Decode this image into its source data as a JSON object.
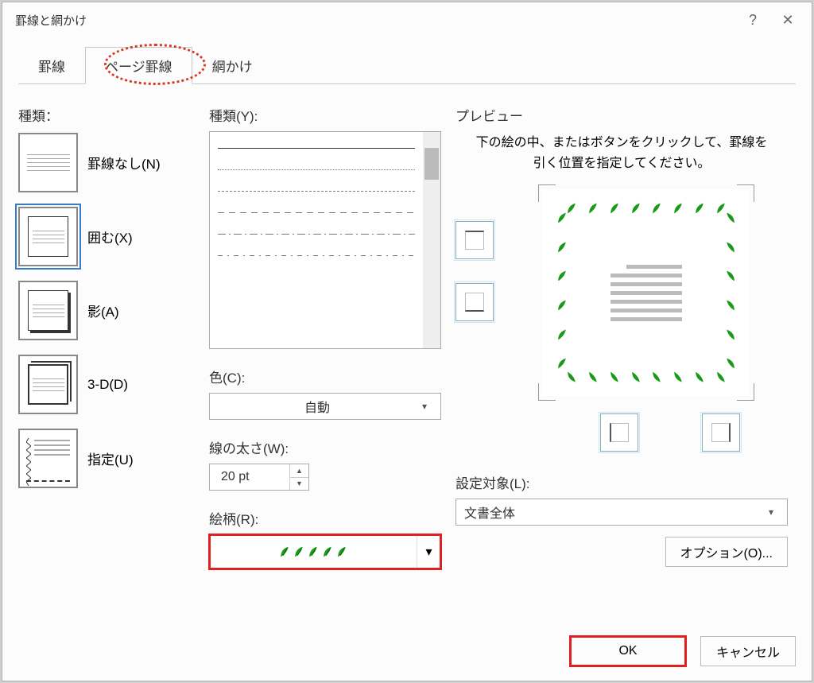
{
  "window": {
    "title": "罫線と網かけ"
  },
  "tabs": {
    "borders": "罫線",
    "page_borders": "ページ罫線",
    "shading": "網かけ"
  },
  "col1": {
    "heading": "種類：",
    "items": [
      {
        "label": "罫線なし(N)",
        "key": "none"
      },
      {
        "label": "囲む(X)",
        "key": "box"
      },
      {
        "label": "影(A)",
        "key": "shadow"
      },
      {
        "label": "3-D(D)",
        "key": "3d"
      },
      {
        "label": "指定(U)",
        "key": "custom"
      }
    ],
    "selected": "box"
  },
  "col2": {
    "style_heading": "種類(Y):",
    "color_heading": "色(C):",
    "color_value": "自動",
    "width_heading": "線の太さ(W):",
    "width_value": "20 pt",
    "art_heading": "絵柄(R):"
  },
  "col3": {
    "heading": "プレビュー",
    "instruction": "下の絵の中、またはボタンをクリックして、罫線を引く位置を指定してください。",
    "apply_heading": "設定対象(L):",
    "apply_value": "文書全体",
    "options_label": "オプション(O)..."
  },
  "footer": {
    "ok": "OK",
    "cancel": "キャンセル"
  },
  "highlights": {
    "page_borders_tab_circled": true,
    "art_box_highlighted": true,
    "ok_highlighted": true
  },
  "art_pattern": {
    "name": "green-sprout-border",
    "glyph_repeat": 5
  }
}
